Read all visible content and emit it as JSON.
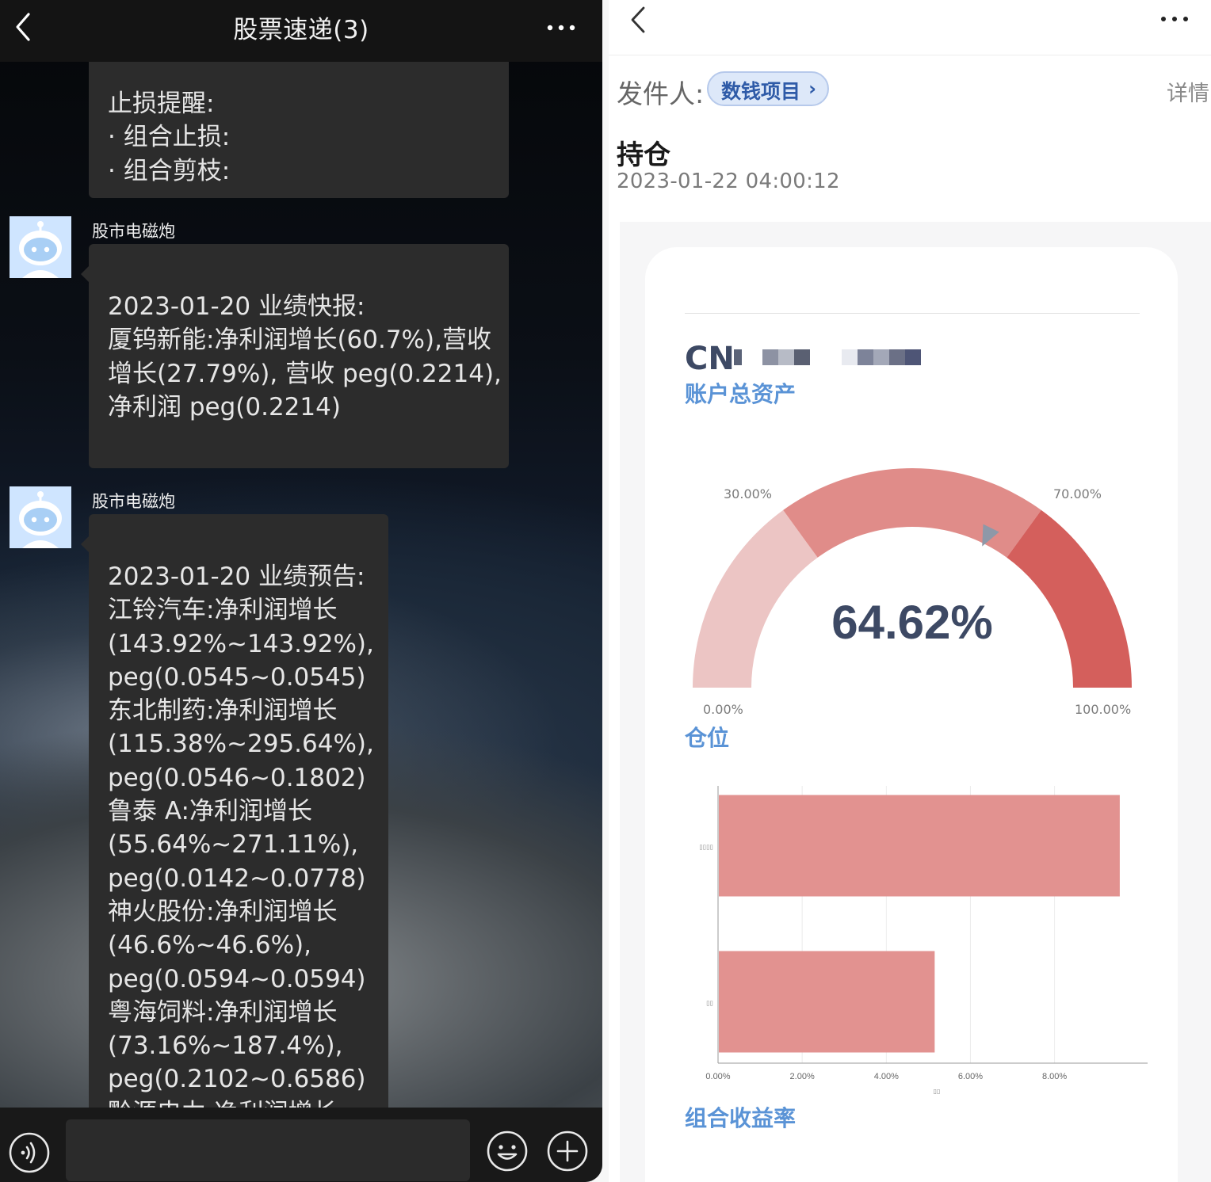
{
  "chat": {
    "title": "股票速递(3)",
    "bubble1_lines": [
      "止损提醒:",
      "· 组合止损:",
      "· 组合剪枝:"
    ],
    "messages": [
      {
        "sender": "股市电磁炮",
        "lines": [
          "2023-01-20 业绩快报:",
          "厦钨新能:净利润增长(60.7%),营收",
          "增长(27.79%), 营收 peg(0.2214),",
          "净利润 peg(0.2214)"
        ]
      },
      {
        "sender": "股市电磁炮",
        "lines": [
          "2023-01-20 业绩预告:",
          "江铃汽车:净利润增长",
          "(143.92%~143.92%),",
          "peg(0.0545~0.0545)",
          "东北制药:净利润增长",
          "(115.38%~295.64%),",
          "peg(0.0546~0.1802)",
          "鲁泰 A:净利润增长",
          "(55.64%~271.11%),",
          "peg(0.0142~0.0778)",
          "神火股份:净利润增长",
          "(46.6%~46.6%),",
          "peg(0.0594~0.0594)",
          "粤海饲料:净利润增长",
          "(73.16%~187.4%),",
          "peg(0.2102~0.6586)",
          "黔源电力:净利润增长"
        ]
      }
    ],
    "input_value": ""
  },
  "mail": {
    "sender_label": "发件人:",
    "sender_name": "数钱项目",
    "sender_chevron": "›",
    "detail_link": "详情",
    "subject": "持仓",
    "date": "2023-01-22 04:00:12",
    "currency_prefix": "CN",
    "total_assets_label": "账户总资产",
    "position_label": "仓位",
    "portfolio_return_label": "组合收益率",
    "colors": {
      "link_blue": "#5a93d6",
      "gauge_light": "#ecc5c4",
      "gauge_mid": "#e08c89",
      "gauge_dark": "#d45f5c",
      "bar": "#e29290"
    }
  },
  "chart_data": [
    {
      "type": "gauge",
      "value": 64.62,
      "value_label": "64.62%",
      "bands": [
        {
          "from": 0,
          "to": 30
        },
        {
          "from": 30,
          "to": 70
        },
        {
          "from": 70,
          "to": 100
        }
      ],
      "tick_labels": [
        "0.00%",
        "30.00%",
        "70.00%",
        "100.00%"
      ],
      "range": [
        0,
        100
      ]
    },
    {
      "type": "bar",
      "orientation": "horizontal",
      "categories": [
        "▯▯▯▯",
        "▯▯"
      ],
      "values": [
        9.55,
        5.15
      ],
      "x_ticks": [
        "0.00%",
        "2.00%",
        "4.00%",
        "6.00%",
        "8.00%"
      ],
      "xlim": [
        0,
        10.4
      ],
      "xlabel": "▯▯",
      "grid": true
    }
  ]
}
